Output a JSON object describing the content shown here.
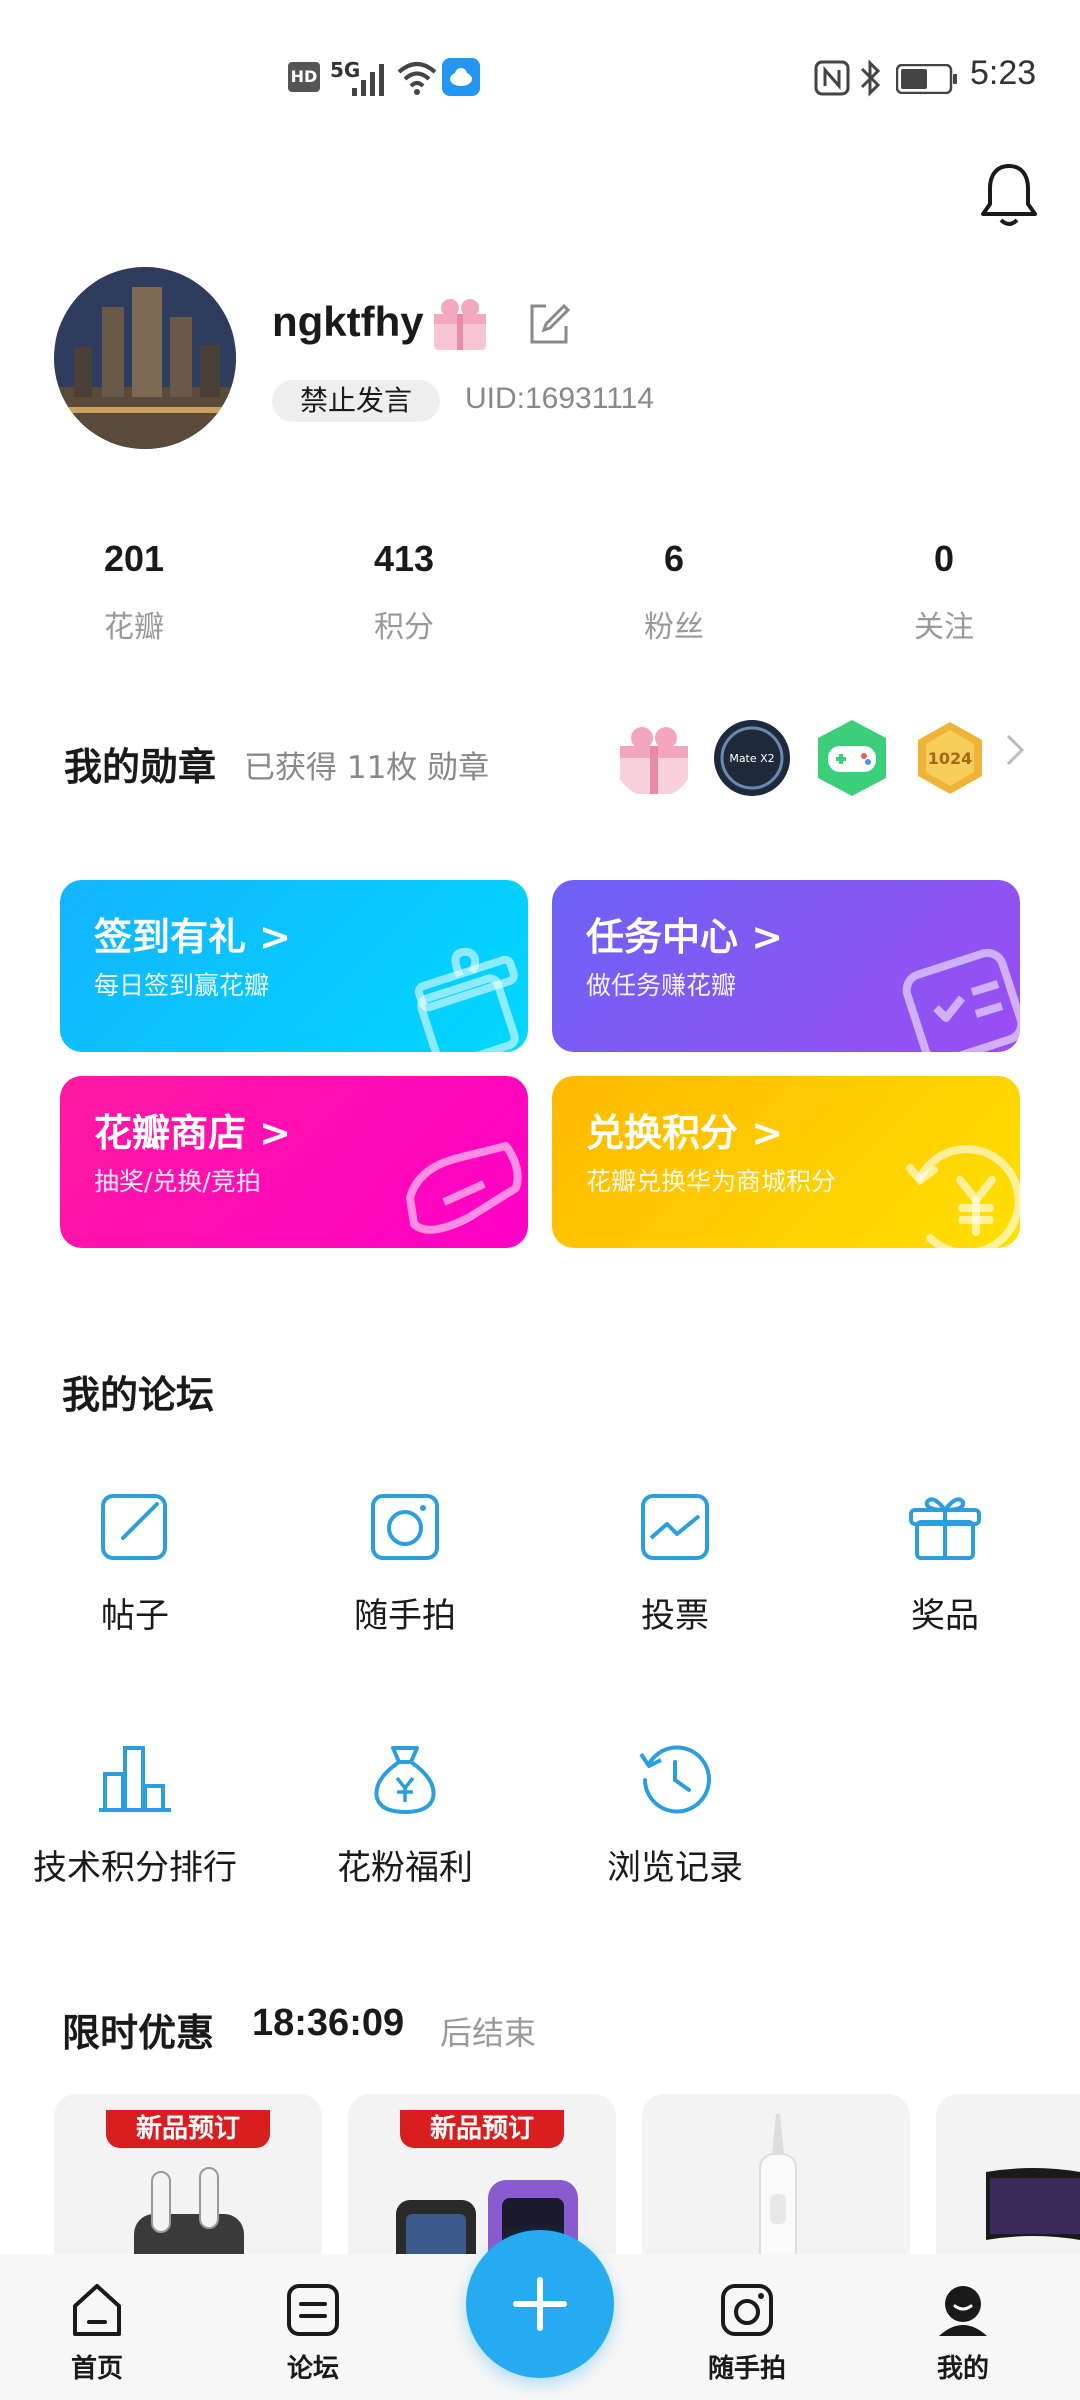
{
  "status_bar": {
    "hd": "HD",
    "network": "5G",
    "time": "5:23"
  },
  "profile": {
    "username": "ngktfhy",
    "ban_label": "禁止发言",
    "uid": "UID:16931114"
  },
  "stats": [
    {
      "value": "201",
      "label": "花瓣"
    },
    {
      "value": "413",
      "label": "积分"
    },
    {
      "value": "6",
      "label": "粉丝"
    },
    {
      "value": "0",
      "label": "关注"
    }
  ],
  "medals": {
    "title": "我的勋章",
    "subtitle": "已获得 11枚 勋章",
    "icons": [
      "gift-medal-icon",
      "mate-x2-medal-icon",
      "gamepad-medal-icon",
      "1024-medal-icon"
    ]
  },
  "cards": [
    {
      "title": "签到有礼 >",
      "subtitle": "每日签到赢花瓣",
      "color": "#1fb6ff"
    },
    {
      "title": "任务中心 >",
      "subtitle": "做任务赚花瓣",
      "color": "#7c5cf5"
    },
    {
      "title": "花瓣商店 >",
      "subtitle": "抽奖/兑换/竞拍",
      "color": "#ff1aa5"
    },
    {
      "title": "兑换积分 >",
      "subtitle": "花瓣兑换华为商城积分",
      "color": "#ffc000"
    }
  ],
  "forum": {
    "title": "我的论坛",
    "items": [
      {
        "label": "帖子",
        "icon": "post-edit-icon"
      },
      {
        "label": "随手拍",
        "icon": "camera-icon"
      },
      {
        "label": "投票",
        "icon": "vote-chart-icon"
      },
      {
        "label": "奖品",
        "icon": "gift-icon"
      },
      {
        "label": "技术积分排行",
        "icon": "bar-ranking-icon"
      },
      {
        "label": "花粉福利",
        "icon": "money-bag-icon"
      },
      {
        "label": "浏览记录",
        "icon": "history-clock-icon"
      }
    ]
  },
  "flash_sale": {
    "title": "限时优惠",
    "countdown": "18:36:09",
    "suffix": "后结束",
    "products": [
      {
        "tag": "新品预订"
      },
      {
        "tag": "新品预订"
      },
      {
        "tag": ""
      },
      {
        "tag": ""
      }
    ]
  },
  "bottom_nav": [
    {
      "label": "首页",
      "icon": "home-icon"
    },
    {
      "label": "论坛",
      "icon": "forum-icon"
    },
    {
      "label": "随手拍",
      "icon": "camera-icon"
    },
    {
      "label": "我的",
      "icon": "profile-icon"
    }
  ],
  "colors": {
    "accent_blue": "#26aaf0",
    "icon_blue": "#2b9ee0",
    "ban_red": "#d81e1e"
  }
}
